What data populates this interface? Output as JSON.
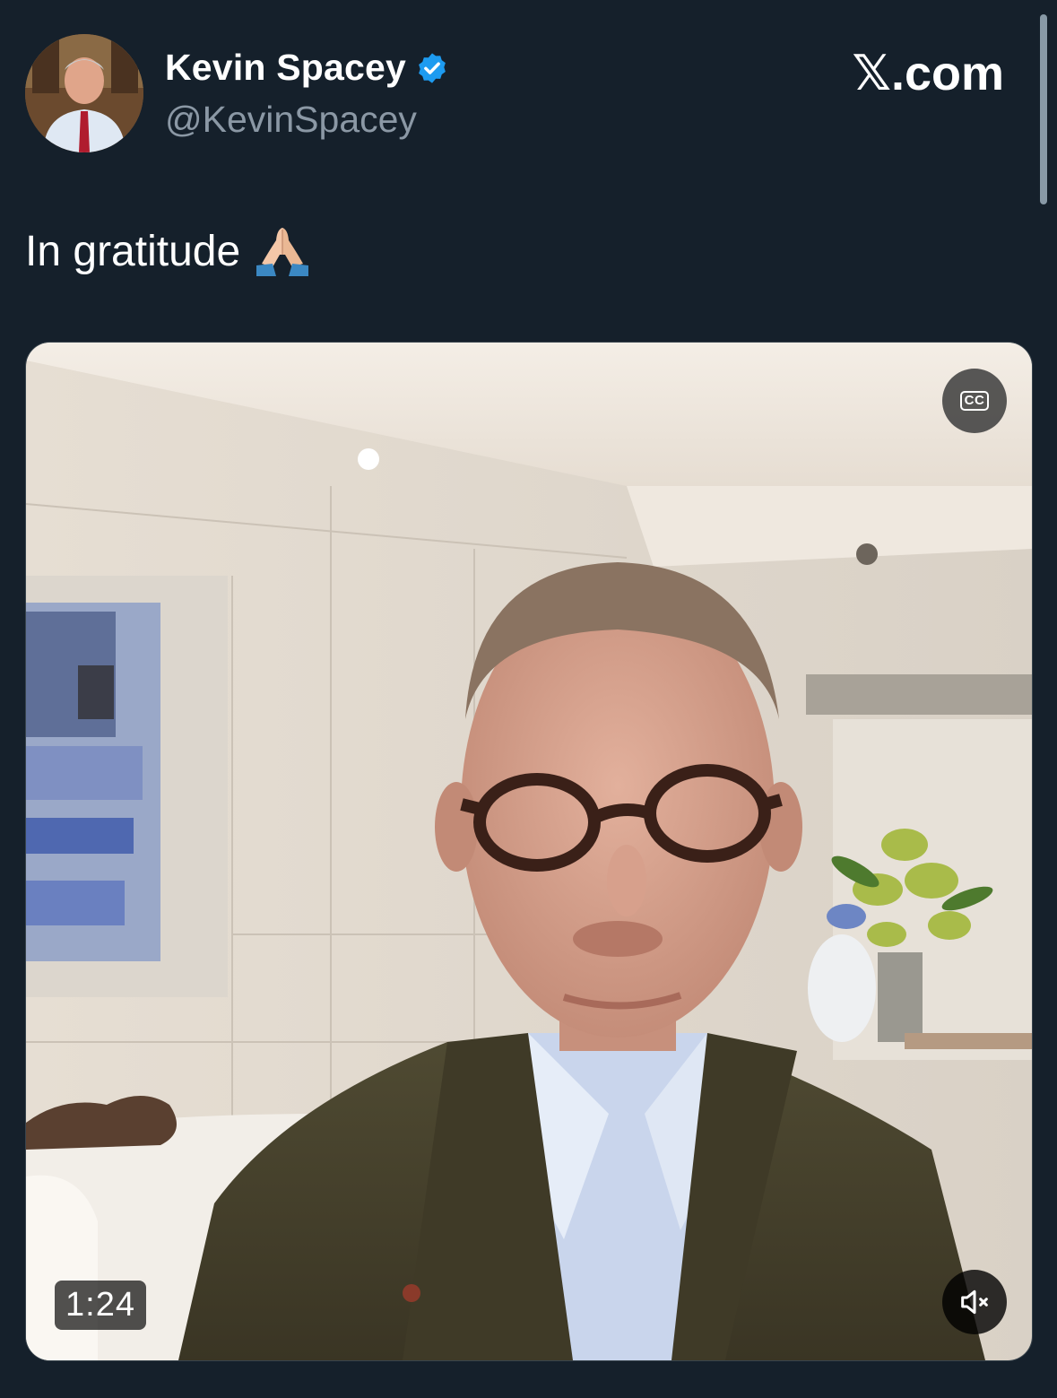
{
  "tweet": {
    "author": {
      "display_name": "Kevin Spacey",
      "handle": "@KevinSpacey",
      "verified": true
    },
    "brand": "𝕏.com",
    "text": "In gratitude",
    "emoji": "folded-hands-emoji"
  },
  "media": {
    "type": "video",
    "duration": "1:24",
    "captions_icon": "cc-icon",
    "mute_icon": "speaker-muted-icon"
  },
  "colors": {
    "background": "#15202b",
    "handle": "#8b98a5",
    "verified": "#1d9bf0"
  }
}
